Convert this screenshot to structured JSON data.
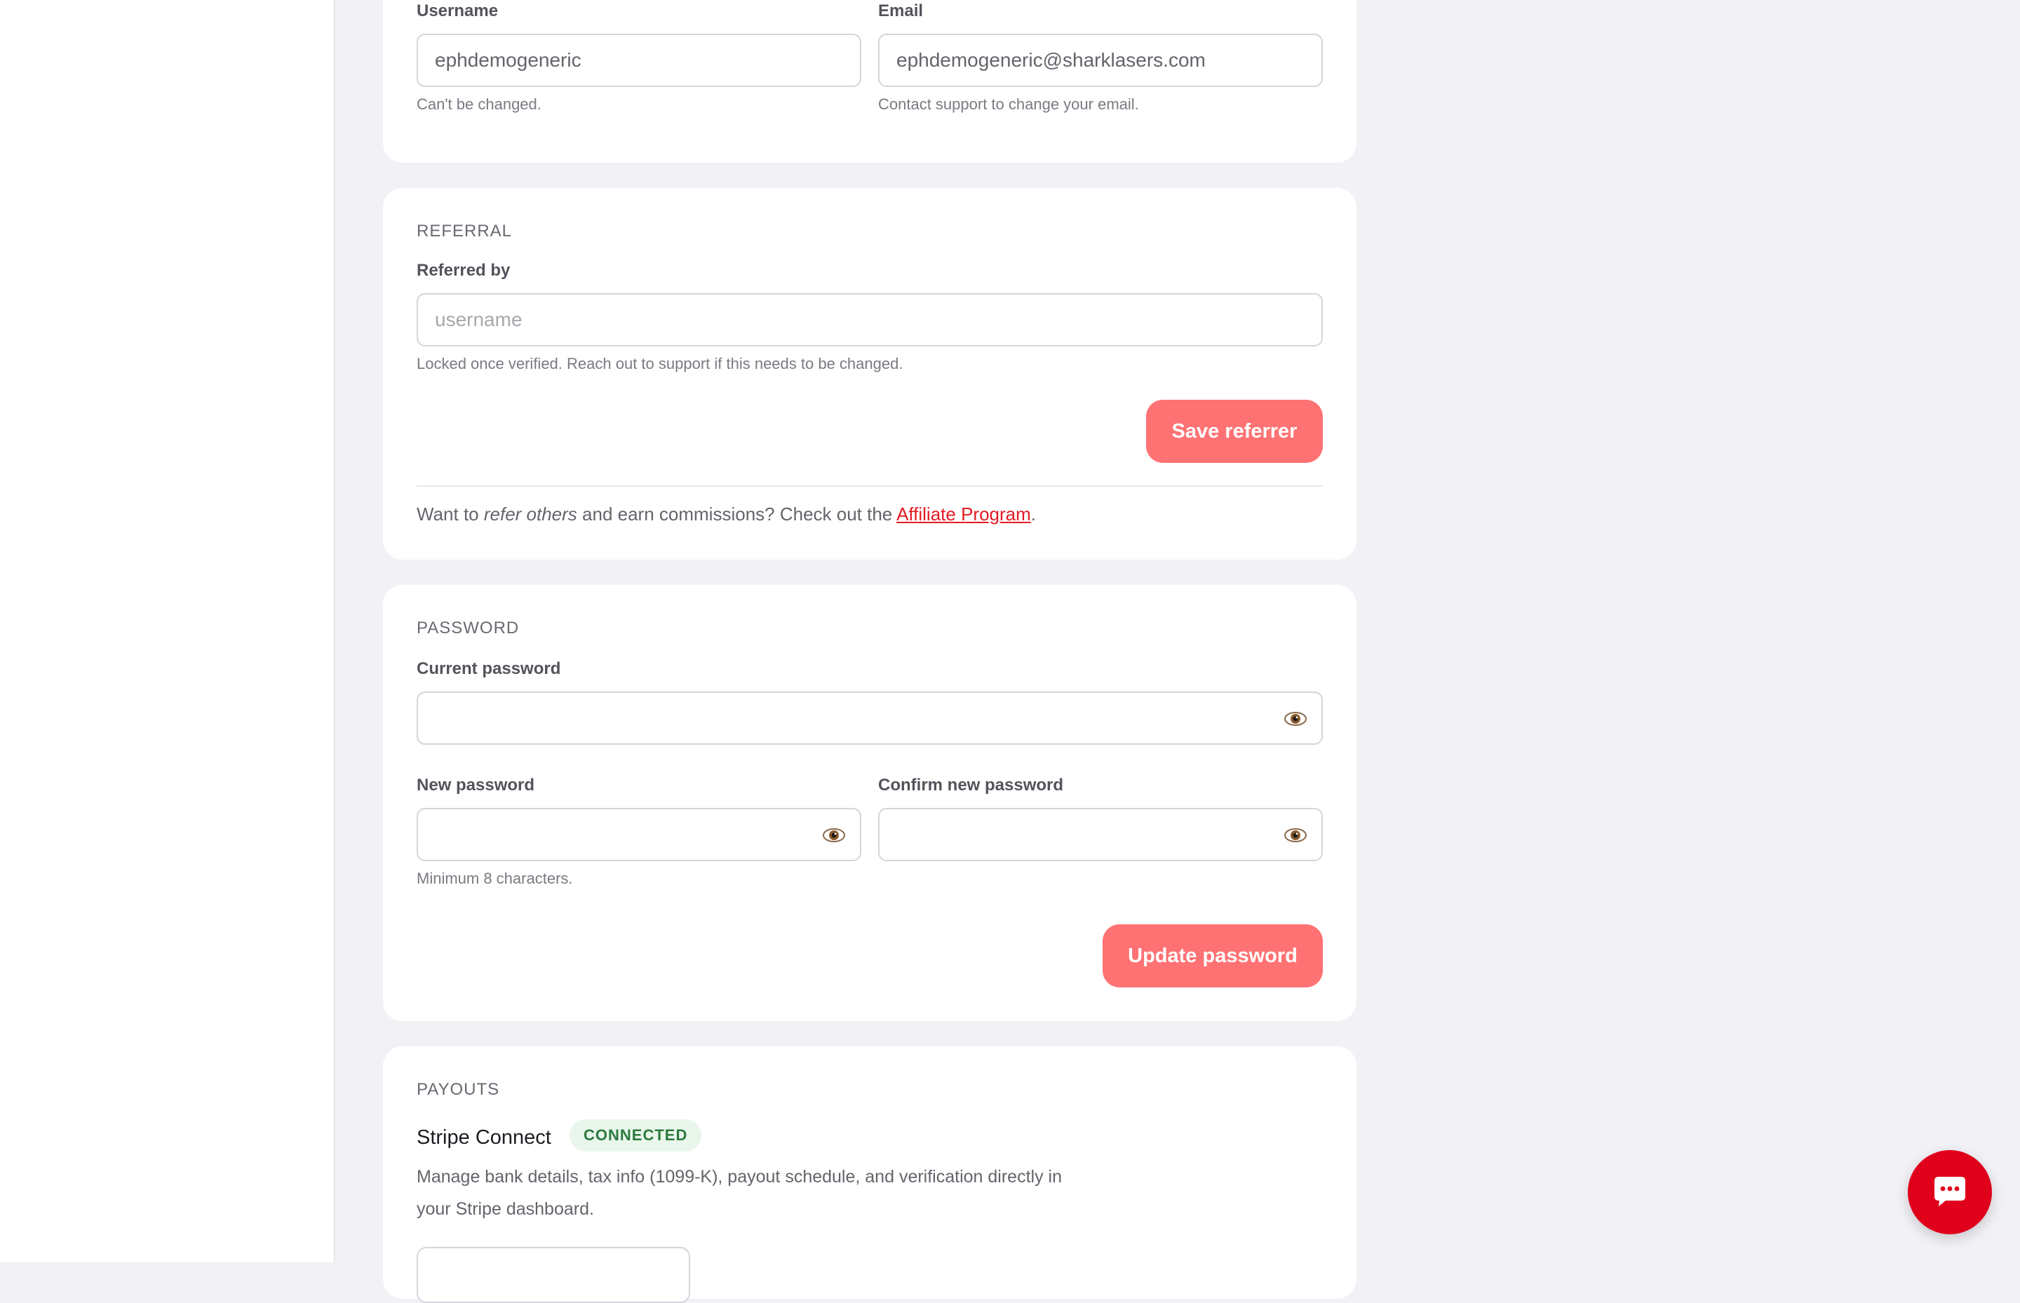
{
  "account": {
    "username_label": "Username",
    "username_value": "ephdemogeneric",
    "username_help": "Can't be changed.",
    "email_label": "Email",
    "email_value": "ephdemogeneric@sharklasers.com",
    "email_help": "Contact support to change your email."
  },
  "referral": {
    "section_title": "REFERRAL",
    "referred_by_label": "Referred by",
    "referred_by_placeholder": "username",
    "referred_by_help": "Locked once verified. Reach out to support if this needs to be changed.",
    "save_button": "Save referrer",
    "promo_prefix": "Want to ",
    "promo_emphasis": "refer others",
    "promo_middle": " and earn commissions? Check out the ",
    "promo_link": "Affiliate Program",
    "promo_suffix": "."
  },
  "password": {
    "section_title": "PASSWORD",
    "current_label": "Current password",
    "new_label": "New password",
    "confirm_label": "Confirm new password",
    "new_help": "Minimum 8 characters.",
    "update_button": "Update password"
  },
  "payouts": {
    "section_title": "PAYOUTS",
    "provider_name": "Stripe Connect",
    "status_badge": "CONNECTED",
    "description_line1": "Manage bank details, tax info (1099-K), payout schedule, and verification directly in",
    "description_line2": "your Stripe dashboard."
  },
  "icons": {
    "password_toggle": "eye-icon",
    "chat": "chat-bubble-icon"
  },
  "colors": {
    "accent": "#ff7274",
    "link": "#e31b23",
    "chat_button": "#e0001b",
    "badge_bg": "#e9f6ec",
    "badge_text": "#2b7a3d"
  }
}
